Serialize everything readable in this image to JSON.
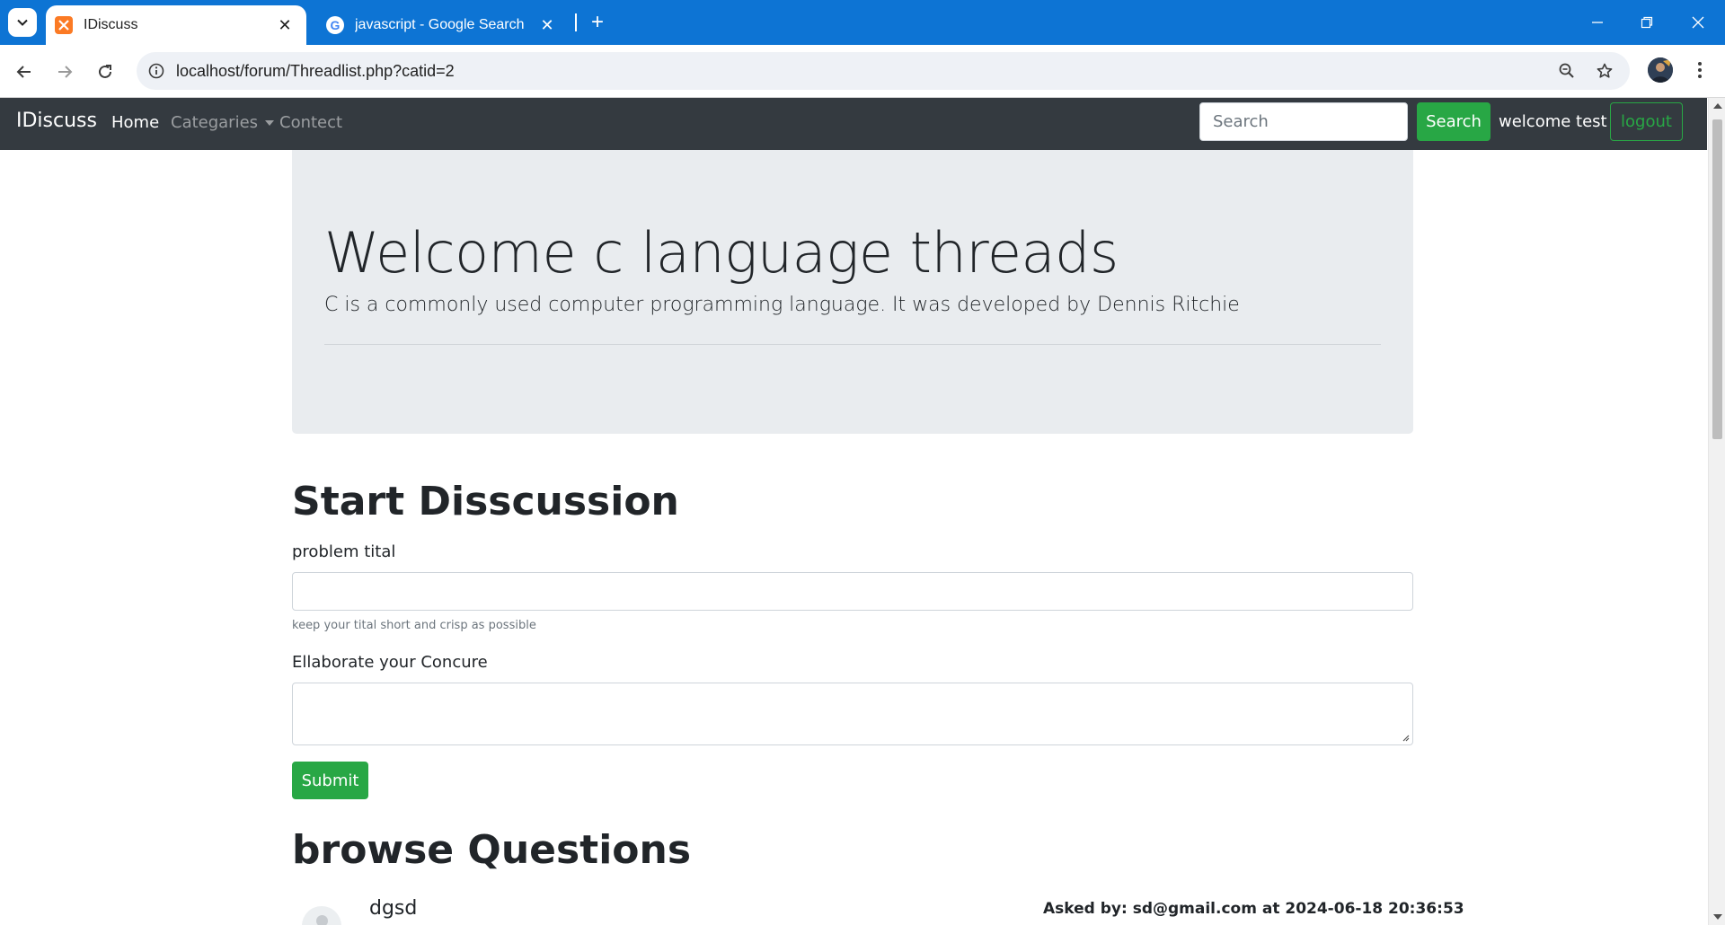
{
  "browser": {
    "tabs": [
      {
        "title": "IDiscuss",
        "active": true,
        "favicon": "xampp-icon"
      },
      {
        "title": "javascript - Google Search",
        "active": false,
        "favicon": "google-icon"
      }
    ],
    "url": "localhost/forum/Threadlist.php?catid=2"
  },
  "navbar": {
    "brand": "IDiscuss",
    "links": [
      {
        "label": "Home"
      },
      {
        "label": "Categaries"
      },
      {
        "label": "Contect"
      }
    ],
    "search_placeholder": "Search",
    "search_button": "Search",
    "welcome": "welcome test",
    "logout": "logout"
  },
  "jumbotron": {
    "title": "Welcome c language threads",
    "lead": "C is a commonly used computer programming language. It was developed by Dennis Ritchie"
  },
  "form": {
    "heading": "Start Disscussion",
    "title_label": "problem tital",
    "title_help": "keep your tital short and crisp as possible",
    "desc_label": "Ellaborate your Concure",
    "submit": "Submit"
  },
  "questions": {
    "heading": "browse Questions",
    "items": [
      {
        "title": "dgsd",
        "meta": "Asked by: sd@gmail.com at 2024-06-18 20:36:53"
      }
    ]
  },
  "colors": {
    "chrome_blue": "#0d74d4",
    "navbar_dark": "#343a40",
    "success_green": "#28a745",
    "jumbotron_gray": "#e9ecef"
  }
}
